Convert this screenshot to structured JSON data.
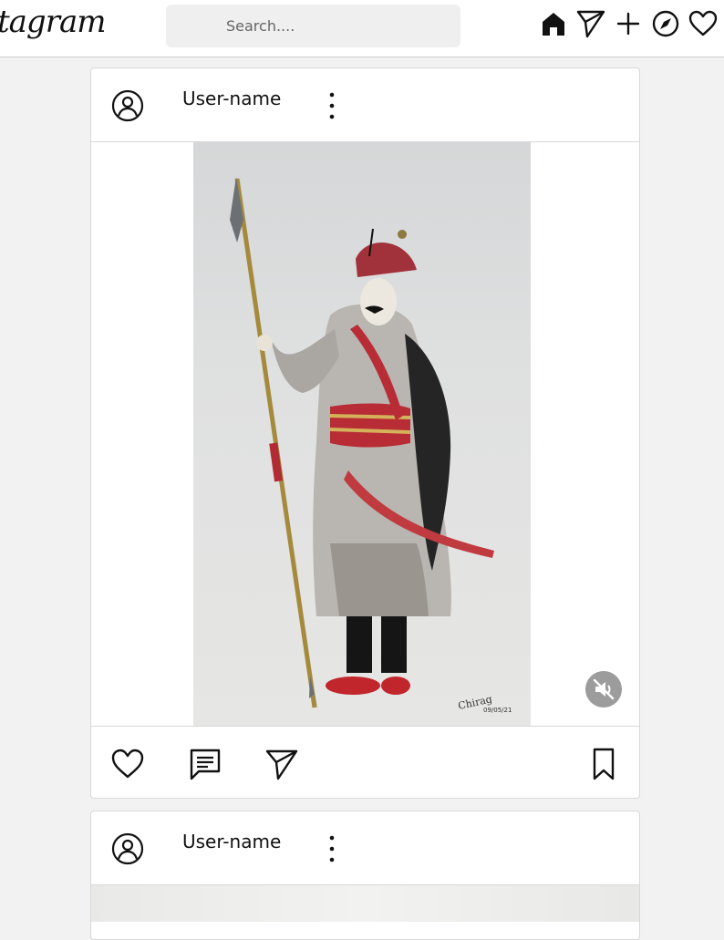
{
  "app": {
    "logo_text": "tagram"
  },
  "search": {
    "placeholder": "Search...."
  },
  "nav": {
    "icons": [
      "home-icon",
      "send-icon",
      "plus-icon",
      "compass-icon",
      "heart-icon"
    ]
  },
  "posts": [
    {
      "username": "User-name",
      "photo_signature": "Chirag",
      "photo_date": "09/05/21",
      "mute_icon": "speaker-muted-icon",
      "actions": [
        "heart-icon",
        "comment-icon",
        "share-icon",
        "bookmark-icon"
      ]
    },
    {
      "username": "User-name"
    }
  ],
  "colors": {
    "background": "#f2f2f2",
    "card": "#ffffff",
    "border": "#d8d8d8",
    "icon": "#111111",
    "mute_button": "#9c9c9c"
  }
}
